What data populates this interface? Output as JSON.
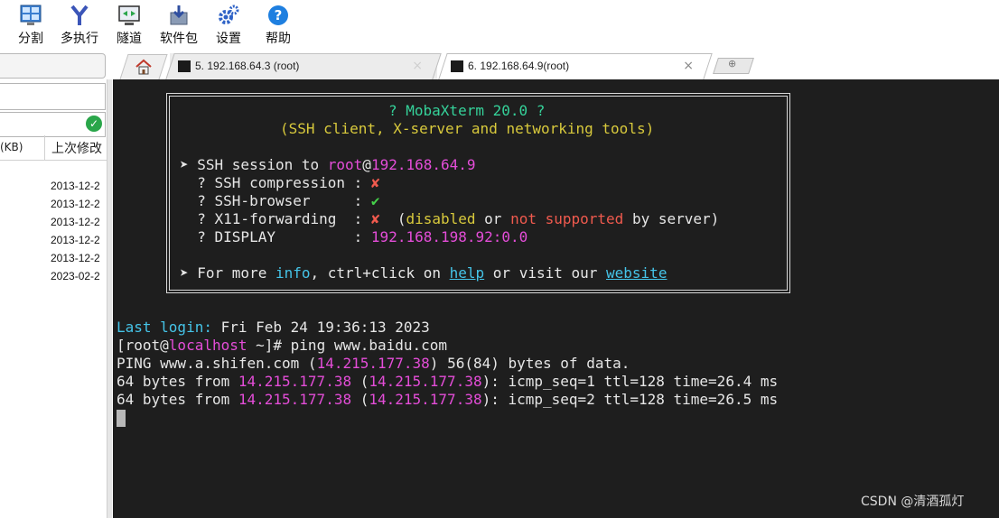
{
  "toolbar": {
    "items": [
      {
        "label": "分割",
        "icon": "split-icon"
      },
      {
        "label": "多执行",
        "icon": "multiexec-icon"
      },
      {
        "label": "隧道",
        "icon": "tunnel-icon"
      },
      {
        "label": "软件包",
        "icon": "packages-icon"
      },
      {
        "label": "设置",
        "icon": "settings-icon"
      },
      {
        "label": "帮助",
        "icon": "help-icon"
      }
    ]
  },
  "tabs": {
    "home_icon": "home-icon",
    "items": [
      {
        "label": "5. 192.168.64.3 (root)",
        "close": "×",
        "active": false
      },
      {
        "label": "6. 192.168.64.9(root)",
        "close": "×",
        "active": true
      }
    ],
    "new_tab_glyph": "⊕"
  },
  "sidebar": {
    "header_size": "(KB)",
    "header_date": "上次修改",
    "dates": [
      "2013-12-2",
      "2013-12-2",
      "2013-12-2",
      "2013-12-2",
      "2013-12-2",
      "2023-02-2"
    ]
  },
  "terminal": {
    "banner": {
      "title": "? MobaXterm 20.0 ?",
      "subtitle": "(SSH client, X-server and networking tools)",
      "session_prefix": "➤ SSH session to ",
      "session_user": "root",
      "session_at": "@",
      "session_host": "192.168.64.9",
      "compression_label": "  ? SSH compression : ",
      "compression_value": "✘",
      "browser_label": "  ? SSH-browser     : ",
      "browser_value": "✔",
      "x11_label": "  ? X11-forwarding  : ",
      "x11_value": "✘",
      "x11_note_open": "  (",
      "x11_disabled": "disabled",
      "x11_or": " or ",
      "x11_not": "not",
      "x11_space": " ",
      "x11_supported": "supported",
      "x11_tail": " by server)",
      "display_label": "  ? DISPLAY         : ",
      "display_value": "192.168.198.92:0.0",
      "more_prefix": "➤ For more ",
      "more_info": "info",
      "more_mid": ", ctrl+click on ",
      "more_help": "help",
      "more_mid2": " or visit our ",
      "more_website": "website"
    },
    "last_login_label": "Last login:",
    "last_login_value": " Fri Feb 24 19:36:13 2023",
    "prompt_open": "[root@",
    "prompt_host": "localhost",
    "prompt_close": " ~]# ping www.baidu.com",
    "ping_prefix": "PING www.a.shifen.com (",
    "ping_ip": "14.215.177.38",
    "ping_suffix": ") 56(84) bytes of data.",
    "reply1_a": "64 bytes from ",
    "reply1_ip": "14.215.177.38",
    "reply1_b": " (",
    "reply1_ip2": "14.215.177.38",
    "reply1_c": "): icmp_seq=1 ttl=128 time=26.4 ms",
    "reply2_a": "64 bytes from ",
    "reply2_ip": "14.215.177.38",
    "reply2_b": " (",
    "reply2_ip2": "14.215.177.38",
    "reply2_c": "): icmp_seq=2 ttl=128 time=26.5 ms"
  },
  "watermark": "CSDN @清酒孤灯",
  "colors": {
    "terminal_bg": "#1e1e1e",
    "green": "#35d29a",
    "yellow": "#d8c93c",
    "magenta": "#e44dd8",
    "red": "#f05a4e",
    "cyan": "#45c4e8"
  }
}
